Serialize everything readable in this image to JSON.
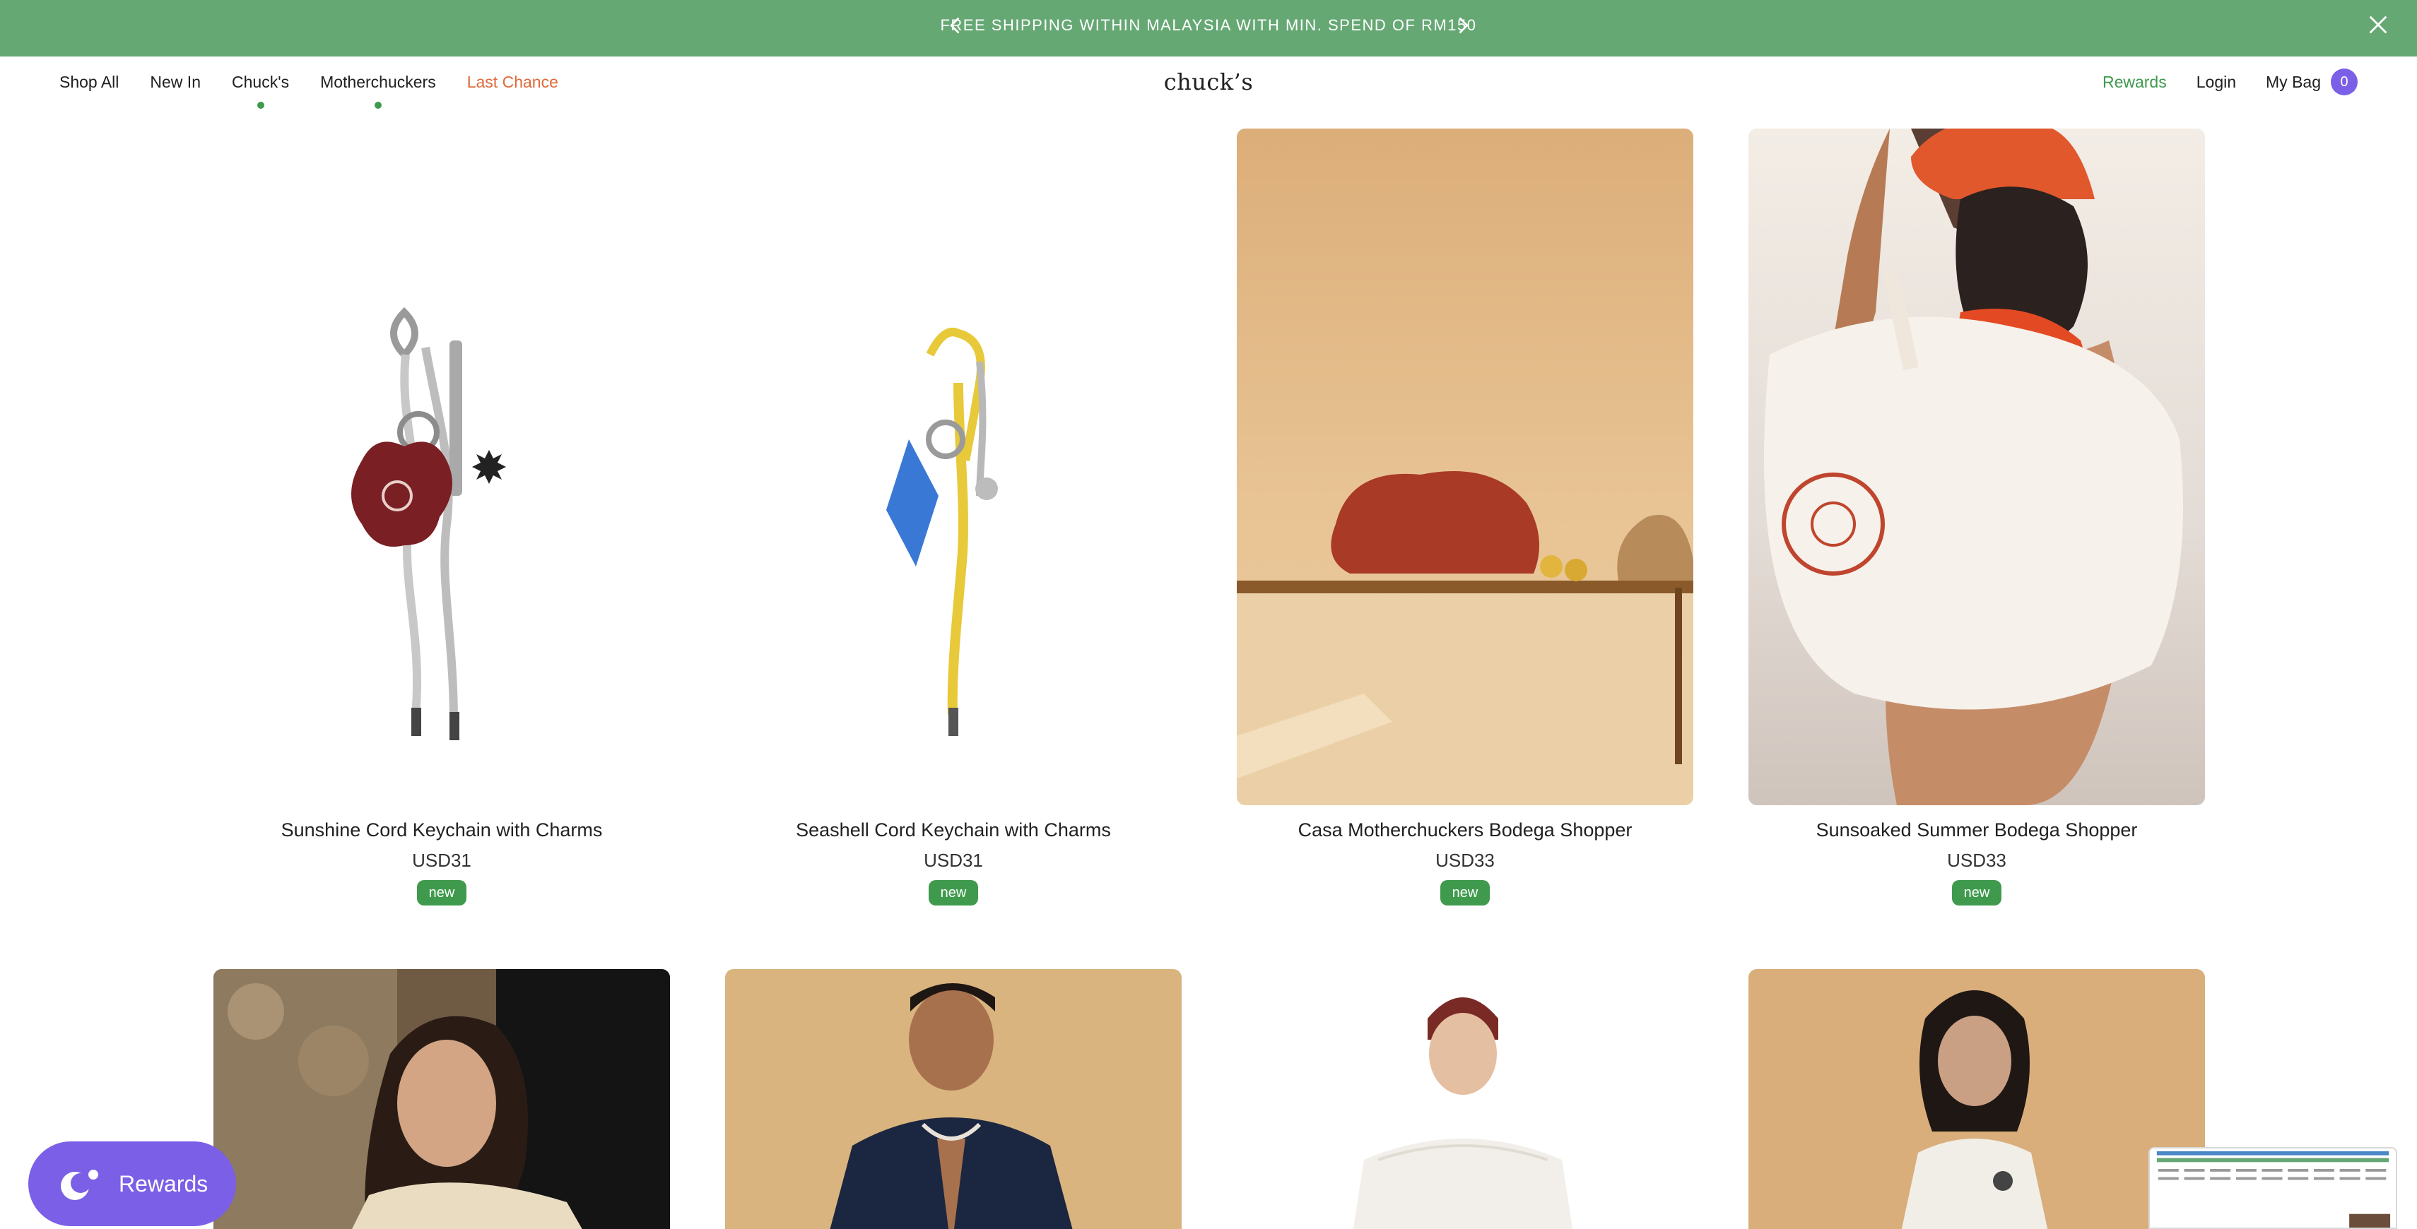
{
  "announcement": {
    "text": "FREE SHIPPING WITHIN MALAYSIA WITH MIN. SPEND OF RM150",
    "prev_icon": "chevron-left-icon",
    "next_icon": "chevron-right-icon",
    "close_icon": "close-icon",
    "bg_color": "#66a874"
  },
  "header": {
    "nav": [
      {
        "label": "Shop All",
        "active": false
      },
      {
        "label": "New In",
        "active": false
      },
      {
        "label": "Chuck's",
        "active": true
      },
      {
        "label": "Motherchuckers",
        "active": true
      },
      {
        "label": "Last Chance",
        "active": false,
        "color": "#e0693a"
      }
    ],
    "brand": "chuck’s",
    "right": {
      "rewards": "Rewards",
      "login": "Login",
      "bag_label": "My Bag",
      "bag_count": "0"
    }
  },
  "products": [
    {
      "name": "Sunshine Cord Keychain with Charms",
      "price": "USD31",
      "badge": "new"
    },
    {
      "name": "Seashell Cord Keychain with Charms",
      "price": "USD31",
      "badge": "new"
    },
    {
      "name": "Casa Motherchuckers Bodega Shopper",
      "price": "USD33",
      "badge": "new"
    },
    {
      "name": "Sunsoaked Summer Bodega Shopper",
      "price": "USD33",
      "badge": "new"
    }
  ],
  "floating_rewards": {
    "label": "Rewards",
    "icon": "rewards-logo-icon",
    "color": "#7b5fe6"
  },
  "colors": {
    "accent_green": "#3f9a4d",
    "purple": "#7b5fe6",
    "last_chance": "#e0693a"
  }
}
